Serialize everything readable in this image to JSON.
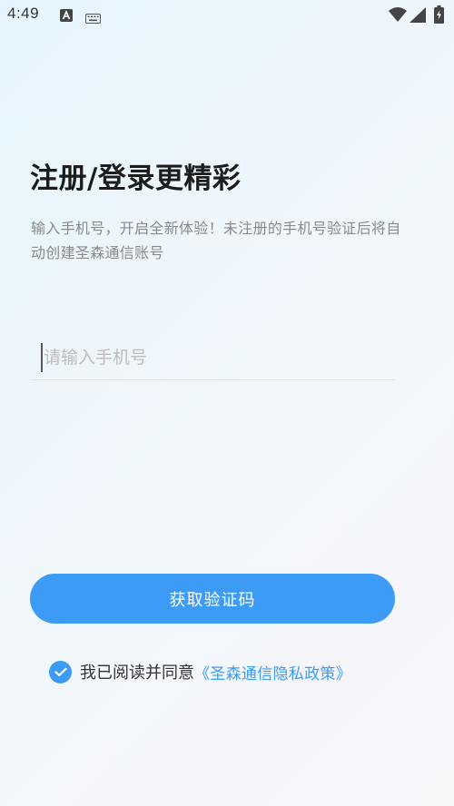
{
  "status_bar": {
    "time": "4:49",
    "icons": [
      "a-letter-icon",
      "keyboard-icon",
      "wifi-icon",
      "signal-icon",
      "battery-charging-icon"
    ]
  },
  "login": {
    "title": "注册/登录更精彩",
    "subtitle": "输入手机号，开启全新体验！未注册的手机号验证后将自动创建圣森通信账号",
    "phone_placeholder": "请输入手机号",
    "phone_value": "",
    "get_code_label": "获取验证码",
    "agree_checked": true,
    "agree_text": "我已阅读并同意",
    "privacy_link": "《圣森通信隐私政策》"
  },
  "colors": {
    "accent": "#3b9bf5",
    "title": "#1c1c1c",
    "subtitle": "#8a8a8a",
    "placeholder": "#bcbcbc"
  }
}
